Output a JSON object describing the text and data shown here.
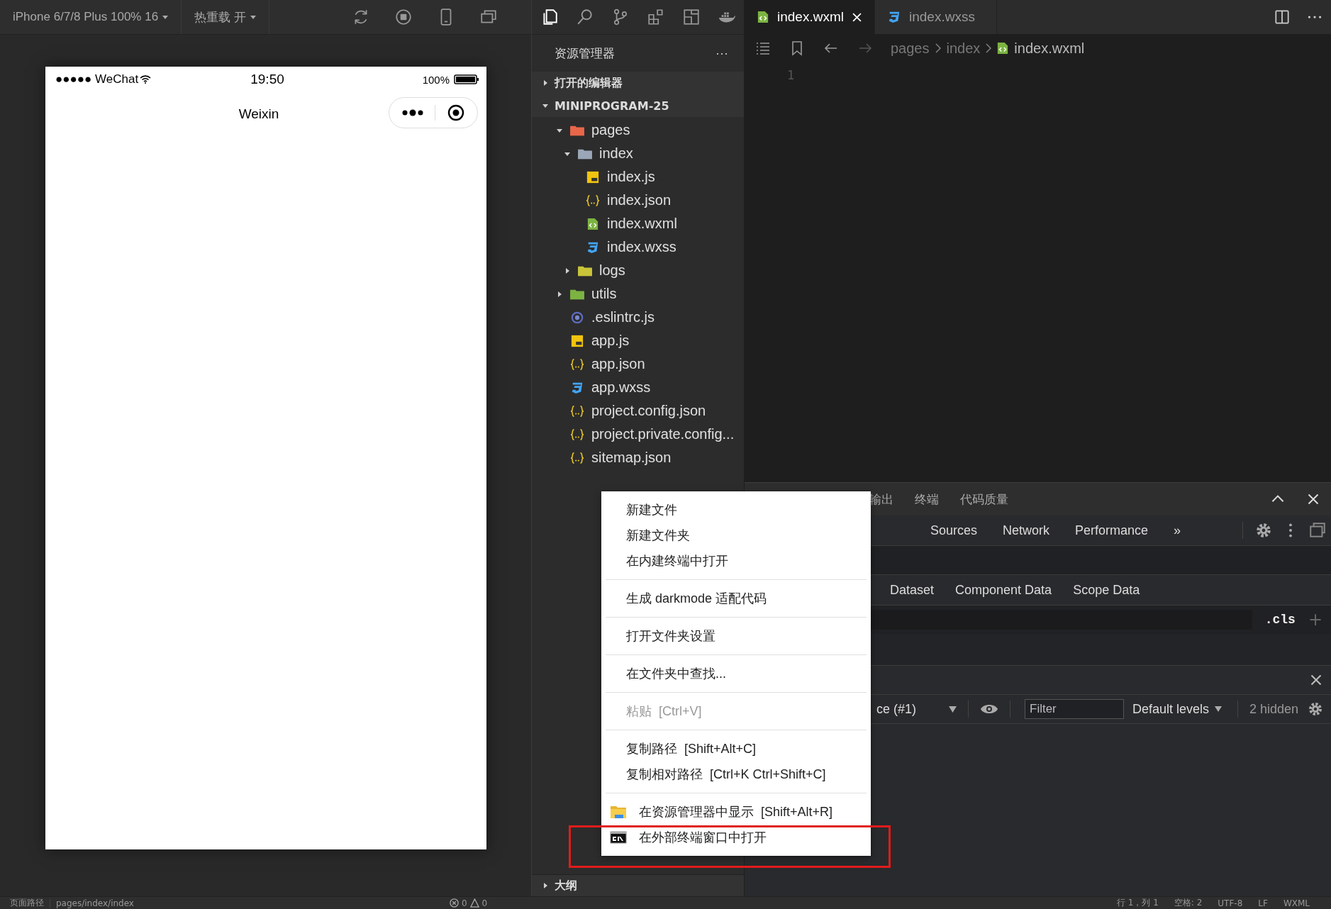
{
  "simulator": {
    "device": "iPhone 6/7/8 Plus 100% 16",
    "hot_reload": "热重载 开",
    "phone": {
      "carrier": "●●●●● WeChat",
      "time": "19:50",
      "battery": "100%",
      "title": "Weixin"
    }
  },
  "explorer": {
    "title": "资源管理器",
    "more": "···",
    "sections": [
      {
        "label": "打开的编辑器",
        "expanded": false
      },
      {
        "label": "MINIPROGRAM-25",
        "expanded": true
      }
    ],
    "tree": [
      {
        "label": "pages",
        "kind": "folder",
        "color": "#e8674a",
        "expanded": true,
        "children": [
          {
            "label": "index",
            "kind": "folder",
            "color": "#9aa7b8",
            "expanded": true,
            "children": [
              {
                "label": "index.js",
                "kind": "js"
              },
              {
                "label": "index.json",
                "kind": "json"
              },
              {
                "label": "index.wxml",
                "kind": "wxml"
              },
              {
                "label": "index.wxss",
                "kind": "wxss"
              }
            ]
          },
          {
            "label": "logs",
            "kind": "folder",
            "color": "#c9c43a",
            "expanded": false
          }
        ]
      },
      {
        "label": "utils",
        "kind": "folder",
        "color": "#7cb342",
        "expanded": false
      },
      {
        "label": ".eslintrc.js",
        "kind": "eslint"
      },
      {
        "label": "app.js",
        "kind": "js"
      },
      {
        "label": "app.json",
        "kind": "json"
      },
      {
        "label": "app.wxss",
        "kind": "wxss"
      },
      {
        "label": "project.config.json",
        "kind": "json"
      },
      {
        "label": "project.private.config...",
        "kind": "json"
      },
      {
        "label": "sitemap.json",
        "kind": "json"
      }
    ],
    "outline": {
      "label": "大纲",
      "expanded": false
    }
  },
  "editor": {
    "tabs": [
      {
        "label": "index.wxml",
        "kind": "wxml",
        "selected": true
      },
      {
        "label": "index.wxss",
        "kind": "wxss",
        "selected": false
      }
    ],
    "breadcrumb": [
      {
        "label": "pages",
        "kind": "folder"
      },
      {
        "label": "index",
        "kind": "folder"
      },
      {
        "label": "index.wxml",
        "kind": "wxml"
      }
    ],
    "line_numbers": [
      "1"
    ]
  },
  "panel": {
    "tabs": [
      "输出",
      "终端",
      "代码质量"
    ],
    "devtools_tabs": [
      "Sources",
      "Network",
      "Performance"
    ],
    "more_tabs": "»",
    "element_tabs": [
      "Dataset",
      "Component Data",
      "Scope Data"
    ],
    "cls": ".cls",
    "add": "+",
    "console": {
      "context": "ce (#1)",
      "filter_placeholder": "Filter",
      "levels": "Default levels",
      "hidden": "2 hidden"
    }
  },
  "context_menu": [
    [
      {
        "label": "新建文件",
        "disabled": false
      },
      {
        "label": "新建文件夹",
        "disabled": false
      },
      {
        "label": "在内建终端中打开",
        "disabled": false
      }
    ],
    [
      {
        "label": "生成 darkmode 适配代码",
        "disabled": false
      }
    ],
    [
      {
        "label": "打开文件夹设置",
        "disabled": false
      }
    ],
    [
      {
        "label": "在文件夹中查找...",
        "disabled": false
      }
    ],
    [
      {
        "label": "粘贴",
        "shortcut": "[Ctrl+V]",
        "disabled": true
      }
    ],
    [
      {
        "label": "复制路径",
        "shortcut": "[Shift+Alt+C]",
        "disabled": false
      },
      {
        "label": "复制相对路径",
        "shortcut": "[Ctrl+K Ctrl+Shift+C]",
        "disabled": false
      }
    ],
    [
      {
        "label": "在资源管理器中显示",
        "shortcut": "[Shift+Alt+R]",
        "disabled": false,
        "kind": "folder"
      },
      {
        "label": "在外部终端窗口中打开",
        "disabled": false,
        "kind": "terminal"
      }
    ]
  ],
  "status_bar": {
    "left": [
      "页面路径",
      "pages/index/index"
    ],
    "errors": "0",
    "warnings": "0",
    "right": [
      "行 1，列 1",
      "空格: 2",
      "UTF-8",
      "LF",
      "WXML"
    ]
  }
}
